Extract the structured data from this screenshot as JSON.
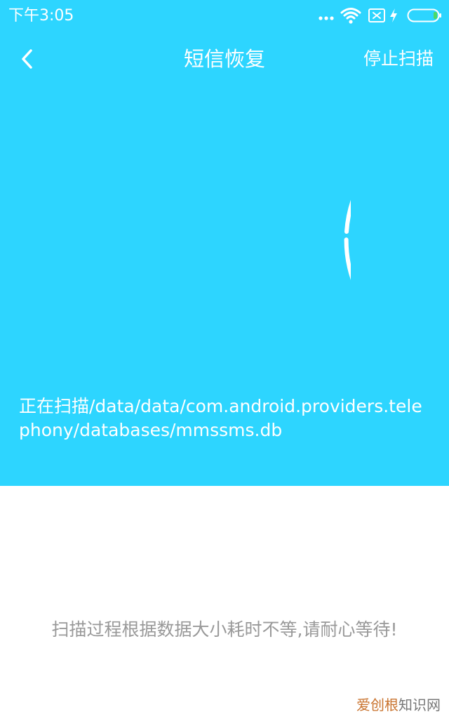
{
  "status_bar": {
    "time": "下午3:05",
    "icons": [
      "more-dots-icon",
      "wifi-icon",
      "sim-disabled-icon",
      "charging-icon",
      "battery-icon"
    ],
    "battery_color": "#4cd964"
  },
  "header": {
    "back_icon": "chevron-left-icon",
    "title": "短信恢复",
    "stop_label": "停止扫描"
  },
  "scan": {
    "progress_ring_color": "#ffffff",
    "path_text": "正在扫描/data/data/com.android.providers.telephony/databases/mmssms.db",
    "hint": "扫描过程根据数据大小耗时不等,请耐心等待!"
  },
  "watermark": {
    "accent_text": "爱创根",
    "rest_text": "知识网"
  },
  "colors": {
    "primary": "#2dd5ff",
    "hint_text": "#999999",
    "background": "#ffffff"
  }
}
